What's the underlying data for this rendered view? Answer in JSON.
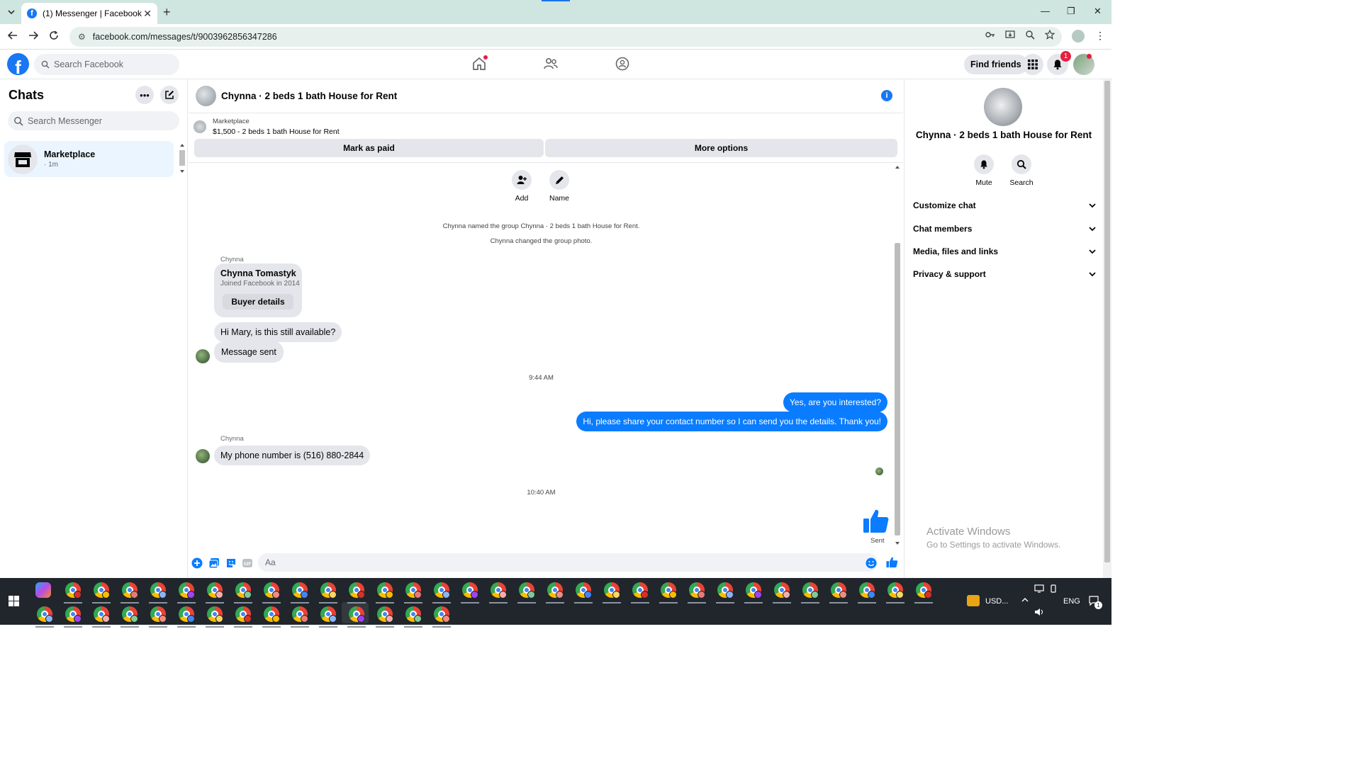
{
  "browser": {
    "tab_title": "(1) Messenger | Facebook",
    "url": "facebook.com/messages/t/9003962856347286"
  },
  "facebook_nav": {
    "search_placeholder": "Search Facebook",
    "find_friends": "Find friends",
    "notification_count": "1"
  },
  "chats": {
    "title": "Chats",
    "search_placeholder": "Search Messenger",
    "items": [
      {
        "name": "Marketplace",
        "time": "· 1m"
      }
    ]
  },
  "conversation": {
    "title": "Chynna · 2 beds 1 bath House for Rent",
    "marketplace": {
      "label": "Marketplace",
      "listing": "$1,500 - 2 beds 1 bath House for Rent",
      "mark_paid": "Mark as paid",
      "more_options": "More options"
    },
    "actions": {
      "add": "Add",
      "name": "Name"
    },
    "system_messages": [
      "Chynna named the group Chynna · 2 beds 1 bath House for Rent.",
      "Chynna changed the group photo."
    ],
    "sender_label_1": "Chynna",
    "buyer_card": {
      "name": "Chynna Tomastyk",
      "joined": "Joined Facebook in 2014",
      "button": "Buyer details"
    },
    "msg_in_1": "Hi Mary, is this still available?",
    "msg_in_2": "Message sent",
    "time_1": "9:44 AM",
    "msg_out_1": "Yes, are you interested?",
    "msg_out_2": "Hi, please share your contact number so I can send you the details. Thank you!",
    "sender_label_2": "Chynna",
    "msg_in_3": "My phone number is (516) 880-2844",
    "time_2": "10:40 AM",
    "sent_status": "Sent",
    "composer_placeholder": "Aa"
  },
  "details_panel": {
    "name": "Chynna · 2 beds 1 bath House for Rent",
    "mute": "Mute",
    "search": "Search",
    "sections": [
      "Customize chat",
      "Chat members",
      "Media, files and links",
      "Privacy & support"
    ]
  },
  "watermark": {
    "line1": "Activate Windows",
    "line2": "Go to Settings to activate Windows."
  },
  "taskbar": {
    "currency": "USD...",
    "language": "ENG",
    "notification_count": "1"
  },
  "colors": {
    "facebook_blue": "#1877f2",
    "messenger_blue": "#0a7cff",
    "notification_red": "#e41e3f"
  }
}
